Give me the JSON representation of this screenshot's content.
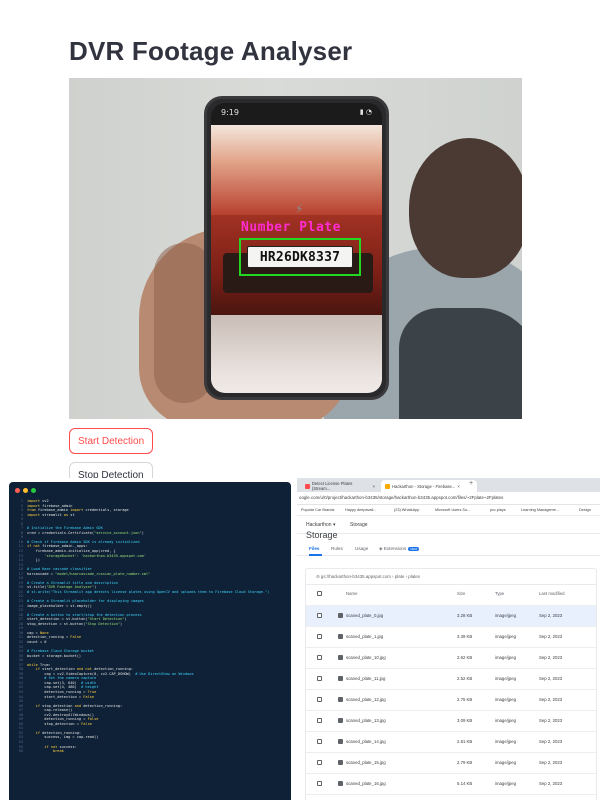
{
  "app": {
    "title": "DVR Footage Analyser",
    "detection_label": "Number Plate",
    "plate_text": "HR26DK8337",
    "phone_time": "9:19",
    "start_button": "Start Detection",
    "stop_button": "Stop Detection"
  },
  "code_editor": {
    "lines": [
      [
        {
          "t": "k",
          "v": "import"
        },
        {
          "t": "c",
          "v": " cv2"
        }
      ],
      [
        {
          "t": "k",
          "v": "import"
        },
        {
          "t": "c",
          "v": " firebase_admin"
        }
      ],
      [
        {
          "t": "k",
          "v": "from"
        },
        {
          "t": "c",
          "v": " firebase_admin "
        },
        {
          "t": "k",
          "v": "import"
        },
        {
          "t": "c",
          "v": " credentials, storage"
        }
      ],
      [
        {
          "t": "k",
          "v": "import"
        },
        {
          "t": "c",
          "v": " streamlit "
        },
        {
          "t": "k",
          "v": "as"
        },
        {
          "t": "c",
          "v": " st"
        }
      ],
      [],
      [],
      [
        {
          "t": "m",
          "v": "# Initialize the Firebase Admin SDK"
        }
      ],
      [
        {
          "t": "c",
          "v": "cred = credentials.Certificate("
        },
        {
          "t": "s",
          "v": "\"service_account.json\""
        },
        {
          "t": "c",
          "v": ")"
        }
      ],
      [],
      [
        {
          "t": "m",
          "v": "# Check if Firebase Admin SDK is already initialized"
        }
      ],
      [
        {
          "t": "k",
          "v": "if not"
        },
        {
          "t": "c",
          "v": " firebase_admin._apps:"
        }
      ],
      [
        {
          "t": "c",
          "v": "    firebase_admin.initialize_app(cred, {"
        }
      ],
      [
        {
          "t": "s",
          "v": "        'storageBucket': 'hackarthon-b3435.appspot.com'"
        }
      ],
      [
        {
          "t": "c",
          "v": "    })"
        }
      ],
      [],
      [
        {
          "t": "m",
          "v": "# Load Haar cascade classifier"
        }
      ],
      [
        {
          "t": "c",
          "v": "harcascade = "
        },
        {
          "t": "s",
          "v": "\"model/haarcascade_russian_plate_number.xml\""
        }
      ],
      [],
      [
        {
          "t": "m",
          "v": "# Create a Streamlit title and description"
        }
      ],
      [
        {
          "t": "c",
          "v": "st.title("
        },
        {
          "t": "s",
          "v": "\"DVR Footage Analyser\""
        },
        {
          "t": "c",
          "v": ")"
        }
      ],
      [
        {
          "t": "m",
          "v": "# st.write(\"This Streamlit app detects license plates using OpenCV and uploads them to Firebase Cloud Storage.\")"
        }
      ],
      [],
      [
        {
          "t": "m",
          "v": "# Create a Streamlit placeholder for displaying images"
        }
      ],
      [
        {
          "t": "c",
          "v": "image_placeholder = st.empty()"
        }
      ],
      [],
      [
        {
          "t": "m",
          "v": "# Create a button to start/stop the detection process"
        }
      ],
      [
        {
          "t": "c",
          "v": "start_detection = st.button("
        },
        {
          "t": "s",
          "v": "\"Start Detection\""
        },
        {
          "t": "c",
          "v": ")"
        }
      ],
      [
        {
          "t": "c",
          "v": "stop_detection = st.button("
        },
        {
          "t": "s",
          "v": "\"Stop Detection\""
        },
        {
          "t": "c",
          "v": ")"
        }
      ],
      [],
      [
        {
          "t": "c",
          "v": "cap = "
        },
        {
          "t": "k",
          "v": "None"
        }
      ],
      [
        {
          "t": "c",
          "v": "detection_running = "
        },
        {
          "t": "k",
          "v": "False"
        }
      ],
      [
        {
          "t": "c",
          "v": "count = 0"
        }
      ],
      [],
      [
        {
          "t": "m",
          "v": "# Firebase Cloud Storage bucket"
        }
      ],
      [
        {
          "t": "c",
          "v": "bucket = storage.bucket()"
        }
      ],
      [],
      [
        {
          "t": "k",
          "v": "while"
        },
        {
          "t": "c",
          "v": " True:"
        }
      ],
      [
        {
          "t": "c",
          "v": "    "
        },
        {
          "t": "k",
          "v": "if"
        },
        {
          "t": "c",
          "v": " start_detection "
        },
        {
          "t": "k",
          "v": "and not"
        },
        {
          "t": "c",
          "v": " detection_running:"
        }
      ],
      [
        {
          "t": "c",
          "v": "        cap = cv2.VideoCapture(0, cv2.CAP_DSHOW)  "
        },
        {
          "t": "m",
          "v": "# Use DirectShow on Windows"
        }
      ],
      [
        {
          "t": "m",
          "v": "        # Set the camera capture"
        }
      ],
      [
        {
          "t": "c",
          "v": "        cap.set(3, 640)  "
        },
        {
          "t": "m",
          "v": "# width"
        }
      ],
      [
        {
          "t": "c",
          "v": "        cap.set(4, 480)  "
        },
        {
          "t": "m",
          "v": "# height"
        }
      ],
      [
        {
          "t": "c",
          "v": "        detection_running = "
        },
        {
          "t": "k",
          "v": "True"
        }
      ],
      [
        {
          "t": "c",
          "v": "        start_detection = "
        },
        {
          "t": "k",
          "v": "False"
        }
      ],
      [],
      [
        {
          "t": "c",
          "v": "    "
        },
        {
          "t": "k",
          "v": "if"
        },
        {
          "t": "c",
          "v": " stop_detection "
        },
        {
          "t": "k",
          "v": "and"
        },
        {
          "t": "c",
          "v": " detection_running:"
        }
      ],
      [
        {
          "t": "c",
          "v": "        cap.release()"
        }
      ],
      [
        {
          "t": "c",
          "v": "        cv2.destroyAllWindows()"
        }
      ],
      [
        {
          "t": "c",
          "v": "        detection_running = "
        },
        {
          "t": "k",
          "v": "False"
        }
      ],
      [
        {
          "t": "c",
          "v": "        stop_detection = "
        },
        {
          "t": "k",
          "v": "False"
        }
      ],
      [],
      [
        {
          "t": "c",
          "v": "    "
        },
        {
          "t": "k",
          "v": "if"
        },
        {
          "t": "c",
          "v": " detection_running:"
        }
      ],
      [
        {
          "t": "c",
          "v": "        success, img = cap.read()"
        }
      ],
      [],
      [
        {
          "t": "c",
          "v": "        "
        },
        {
          "t": "k",
          "v": "if not"
        },
        {
          "t": "c",
          "v": " success:"
        }
      ],
      [
        {
          "t": "c",
          "v": "            "
        },
        {
          "t": "k",
          "v": "break"
        }
      ]
    ]
  },
  "browser": {
    "tabs": [
      "Detect License Plates (Stream...",
      "Hackarthon - Storage - Firebase..."
    ],
    "tab_close": "×",
    "new_tab": "+",
    "address": "oogle.com/u/0/project/hackarthon-b3435/storage/hackarthon-b3435.appspot.com/files/~2Fplate~2Fplates",
    "bookmarks": [
      "Popular Car Brands",
      "Happy deepavali...",
      "(23) WhatsApp",
      "Microsoft Users Su...",
      "pro-plays",
      "Learning Manageme...",
      "Design"
    ],
    "project": "Hackarthon",
    "project_caret": "▾",
    "storage_tab": "Storage",
    "page_title": "Storage",
    "storage_tabs": [
      "Files",
      "Rules",
      "Usage",
      "Extensions"
    ],
    "new_badge": "NEW",
    "path": "gs://hackarthon-b3435.appspot.com › plate › plates",
    "columns": [
      "Name",
      "Size",
      "Type",
      "Last modified"
    ],
    "files": [
      {
        "name": "scaned_plate_0.jpg",
        "size": "3.28 KB",
        "type": "image/jpeg",
        "modified": "Sep 2, 2023"
      },
      {
        "name": "scaned_plate_1.jpg",
        "size": "3.39 KB",
        "type": "image/jpeg",
        "modified": "Sep 2, 2023"
      },
      {
        "name": "scaned_plate_10.jpg",
        "size": "2.62 KB",
        "type": "image/jpeg",
        "modified": "Sep 2, 2023"
      },
      {
        "name": "scaned_plate_11.jpg",
        "size": "2.52 KB",
        "type": "image/jpeg",
        "modified": "Sep 2, 2023"
      },
      {
        "name": "scaned_plate_12.jpg",
        "size": "2.75 KB",
        "type": "image/jpeg",
        "modified": "Sep 2, 2023"
      },
      {
        "name": "scaned_plate_13.jpg",
        "size": "3.09 KB",
        "type": "image/jpeg",
        "modified": "Sep 2, 2023"
      },
      {
        "name": "scaned_plate_14.jpg",
        "size": "2.81 KB",
        "type": "image/jpeg",
        "modified": "Sep 2, 2023"
      },
      {
        "name": "scaned_plate_15.jpg",
        "size": "2.79 KB",
        "type": "image/jpeg",
        "modified": "Sep 2, 2023"
      },
      {
        "name": "scaned_plate_16.jpg",
        "size": "5.14 KB",
        "type": "image/jpeg",
        "modified": "Sep 2, 2023"
      },
      {
        "name": "scaned_plate_17.jpg",
        "size": "5.17 KB",
        "type": "image/jpeg",
        "modified": "Sep 2, 2023"
      }
    ]
  },
  "colors": {
    "accent_red": "#ff4b4b",
    "plate_box": "#22d622",
    "detection_label": "#ff2bd0",
    "firebase_blue": "#1a73e8",
    "editor_bg": "#0f2136"
  }
}
